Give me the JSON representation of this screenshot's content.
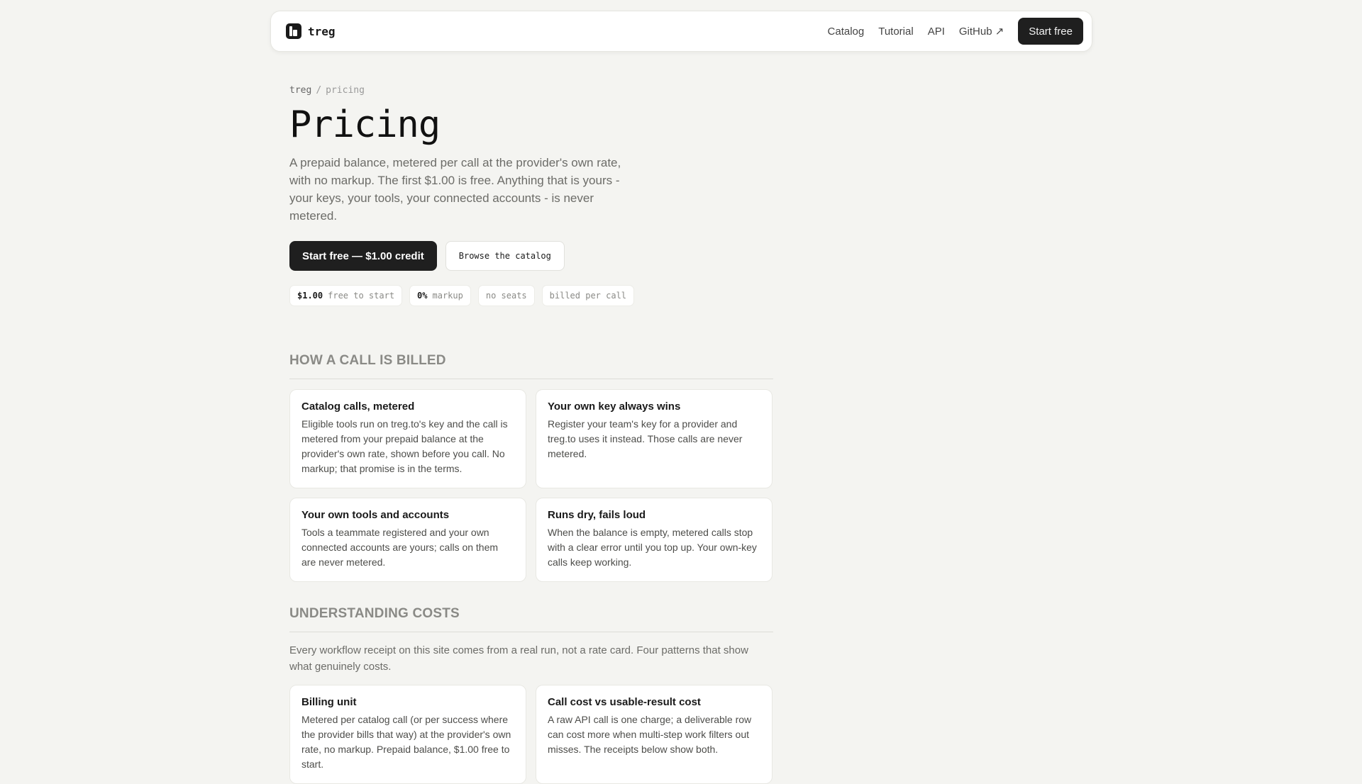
{
  "nav": {
    "brand": "treg",
    "links": [
      "Catalog",
      "Tutorial",
      "API",
      "GitHub ↗"
    ],
    "cta": "Start free"
  },
  "breadcrumb": {
    "root": "treg",
    "sep": "/",
    "current": "pricing"
  },
  "hero": {
    "title": "Pricing",
    "lead": "A prepaid balance, metered per call at the provider's own rate, with no markup. The first $1.00 is free. Anything that is yours - your keys, your tools, your connected accounts - is never metered.",
    "primary_cta": "Start free — $1.00 credit",
    "secondary_cta": "Browse the catalog"
  },
  "chips": [
    {
      "strong": "$1.00",
      "text": "free to start"
    },
    {
      "strong": "0%",
      "text": "markup"
    },
    {
      "strong": "",
      "text": "no seats"
    },
    {
      "strong": "",
      "text": "billed per call"
    }
  ],
  "billing": {
    "heading": "HOW A CALL IS BILLED",
    "cards": [
      {
        "title": "Catalog calls, metered",
        "body": "Eligible tools run on treg.to's key and the call is metered from your prepaid balance at the provider's own rate, shown before you call. No markup; that promise is in the terms."
      },
      {
        "title": "Your own key always wins",
        "body": "Register your team's key for a provider and treg.to uses it instead. Those calls are never metered."
      },
      {
        "title": "Your own tools and accounts",
        "body": "Tools a teammate registered and your own connected accounts are yours; calls on them are never metered."
      },
      {
        "title": "Runs dry, fails loud",
        "body": "When the balance is empty, metered calls stop with a clear error until you top up. Your own-key calls keep working."
      }
    ]
  },
  "costs": {
    "heading": "UNDERSTANDING COSTS",
    "description": "Every workflow receipt on this site comes from a real run, not a rate card. Four patterns that show what genuinely costs.",
    "cards": [
      {
        "title": "Billing unit",
        "body": "Metered per catalog call (or per success where the provider bills that way) at the provider's own rate, no markup. Prepaid balance, $1.00 free to start."
      },
      {
        "title": "Call cost vs usable-result cost",
        "body": "A raw API call is one charge; a deliverable row can cost more when multi-step work filters out misses. The receipts below show both."
      }
    ]
  }
}
